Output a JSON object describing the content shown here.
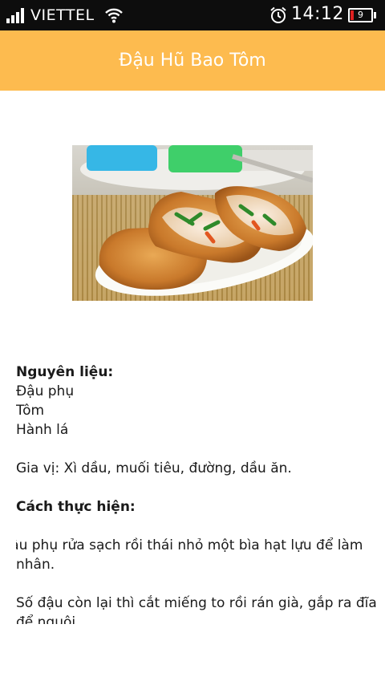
{
  "status_bar": {
    "carrier": "VIETTEL",
    "time": "14:12",
    "battery": "9",
    "battery_color": "#e02020"
  },
  "header": {
    "title": "Đậu Hũ Bao Tôm",
    "background": "#fdbb4f"
  },
  "image": {
    "icon": "food-photo"
  },
  "recipe": {
    "ingredients_heading": "Nguyên liệu:",
    "ingredients": [
      "Đậu phụ",
      "Tôm",
      "Hành lá"
    ],
    "seasoning": "Gia vị: Xì dầu, muối tiêu, đường, dầu ăn.",
    "method_heading": "Cách thực hiện:",
    "steps": [
      "Đậu phụ rửa sạch rồi thái nhỏ một bìa hạt lựu để làm nhân.",
      "Số đậu còn lại thì cắt miếng to rồi rán già, gắp ra đĩa để nguội."
    ]
  }
}
